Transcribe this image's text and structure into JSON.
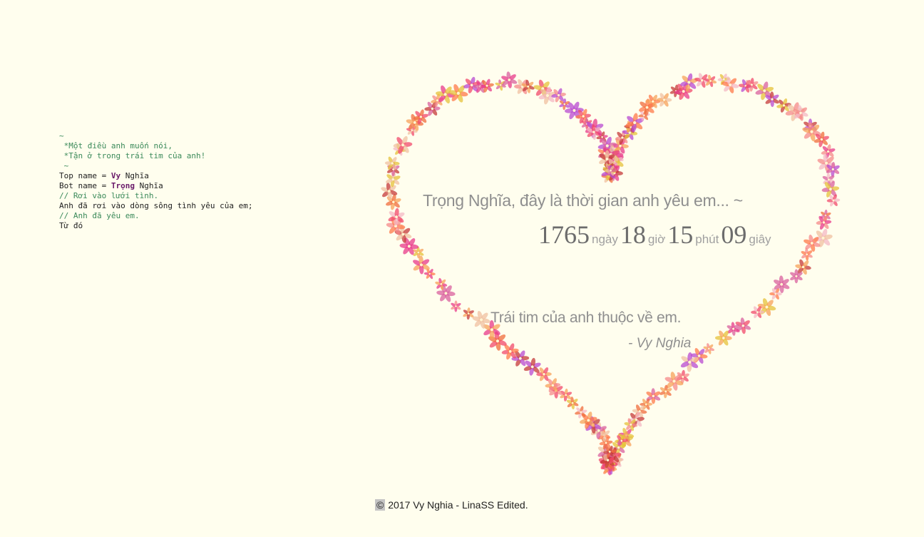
{
  "code": {
    "lines": [
      {
        "parts": [
          {
            "t": "~",
            "c": "cmt"
          }
        ]
      },
      {
        "parts": [
          {
            "t": " *Một điều anh muốn nói,",
            "c": "cmt"
          }
        ]
      },
      {
        "parts": [
          {
            "t": " *Tận ở trong trái tim của anh!",
            "c": "cmt"
          }
        ]
      },
      {
        "parts": [
          {
            "t": " ~",
            "c": "cmt"
          }
        ]
      },
      {
        "parts": [
          {
            "t": "Top name = ",
            "c": ""
          },
          {
            "t": "Vy",
            "c": "kw"
          },
          {
            "t": " Nghĩa",
            "c": ""
          }
        ]
      },
      {
        "parts": [
          {
            "t": "Bot name = ",
            "c": ""
          },
          {
            "t": "Trọng",
            "c": "kw"
          },
          {
            "t": " Nghĩa",
            "c": ""
          }
        ]
      },
      {
        "parts": [
          {
            "t": "// Rơi vào lưới tình.",
            "c": "cmt"
          }
        ]
      },
      {
        "parts": [
          {
            "t": "Anh đã rơi vào dòng sông tình yêu của em;",
            "c": ""
          }
        ]
      },
      {
        "parts": [
          {
            "t": "// Anh đã yêu em.",
            "c": "cmt"
          }
        ]
      },
      {
        "parts": [
          {
            "t": "Từ đó",
            "c": ""
          }
        ]
      }
    ]
  },
  "message": "Trọng Nghĩa, đây là thời gian anh yêu em... ~",
  "elapsed": {
    "days": "1765",
    "days_unit": "ngày",
    "hours": "18",
    "hours_unit": "giờ",
    "minutes": "15",
    "minutes_unit": "phút",
    "seconds": "09",
    "seconds_unit": "giây"
  },
  "love_line": "Trái tim của anh thuộc về em.",
  "signature": "- Vy Nghia",
  "footer": {
    "symbol": "©",
    "text": " 2017 Vy Nghia - LinaSS Edited."
  },
  "colors": {
    "background": "#fffeee",
    "flower_palette": [
      "#f24a6b",
      "#f7a15a",
      "#e83a8a",
      "#f06c3c",
      "#f4b8c4",
      "#e6c13a",
      "#d9609e",
      "#f58a8a",
      "#c53a3a",
      "#f0c0a0",
      "#b84ad0",
      "#ff7a4a"
    ]
  }
}
